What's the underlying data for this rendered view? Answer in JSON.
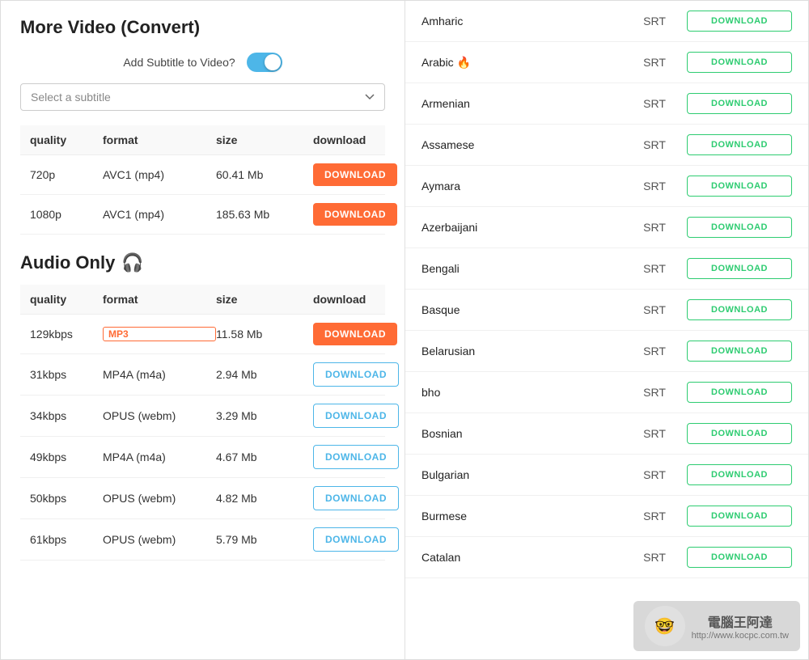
{
  "left": {
    "section_title": "More Video (Convert)",
    "subtitle_label": "Add Subtitle to Video?",
    "toggle_on": true,
    "subtitle_placeholder": "Select a subtitle",
    "video_table": {
      "headers": [
        "quality",
        "format",
        "size",
        "download"
      ],
      "rows": [
        {
          "quality": "720p",
          "format": "AVC1 (mp4)",
          "size": "60.41 Mb",
          "btn": "DOWNLOAD",
          "btn_type": "orange"
        },
        {
          "quality": "1080p",
          "format": "AVC1 (mp4)",
          "size": "185.63 Mb",
          "btn": "DOWNLOAD",
          "btn_type": "orange"
        }
      ]
    },
    "audio_title": "Audio Only",
    "audio_table": {
      "headers": [
        "quality",
        "format",
        "size",
        "download"
      ],
      "rows": [
        {
          "quality": "129kbps",
          "format": "MP3",
          "format_badge": true,
          "size": "11.58 Mb",
          "btn": "DOWNLOAD",
          "btn_type": "orange"
        },
        {
          "quality": "31kbps",
          "format": "MP4A (m4a)",
          "format_badge": false,
          "size": "2.94 Mb",
          "btn": "DOWNLOAD",
          "btn_type": "outline"
        },
        {
          "quality": "34kbps",
          "format": "OPUS (webm)",
          "format_badge": false,
          "size": "3.29 Mb",
          "btn": "DOWNLOAD",
          "btn_type": "outline"
        },
        {
          "quality": "49kbps",
          "format": "MP4A (m4a)",
          "format_badge": false,
          "size": "4.67 Mb",
          "btn": "DOWNLOAD",
          "btn_type": "outline"
        },
        {
          "quality": "50kbps",
          "format": "OPUS (webm)",
          "format_badge": false,
          "size": "4.82 Mb",
          "btn": "DOWNLOAD",
          "btn_type": "outline"
        },
        {
          "quality": "61kbps",
          "format": "OPUS (webm)",
          "format_badge": false,
          "size": "5.79 Mb",
          "btn": "DOWNLOAD",
          "btn_type": "outline"
        }
      ]
    }
  },
  "right": {
    "subtitles": [
      {
        "lang": "Amharic",
        "emoji": "",
        "format": "SRT",
        "btn": "DOWNLOAD"
      },
      {
        "lang": "Arabic",
        "emoji": "🔥",
        "format": "SRT",
        "btn": "DOWNLOAD"
      },
      {
        "lang": "Armenian",
        "emoji": "",
        "format": "SRT",
        "btn": "DOWNLOAD"
      },
      {
        "lang": "Assamese",
        "emoji": "",
        "format": "SRT",
        "btn": "DOWNLOAD"
      },
      {
        "lang": "Aymara",
        "emoji": "",
        "format": "SRT",
        "btn": "DOWNLOAD"
      },
      {
        "lang": "Azerbaijani",
        "emoji": "",
        "format": "SRT",
        "btn": "DOWNLOAD"
      },
      {
        "lang": "Bengali",
        "emoji": "",
        "format": "SRT",
        "btn": "DOWNLOAD"
      },
      {
        "lang": "Basque",
        "emoji": "",
        "format": "SRT",
        "btn": "DOWNLOAD"
      },
      {
        "lang": "Belarusian",
        "emoji": "",
        "format": "SRT",
        "btn": "DOWNLOAD"
      },
      {
        "lang": "bho",
        "emoji": "",
        "format": "SRT",
        "btn": "DOWNLOAD"
      },
      {
        "lang": "Bosnian",
        "emoji": "",
        "format": "SRT",
        "btn": "DOWNLOAD"
      },
      {
        "lang": "Bulgarian",
        "emoji": "",
        "format": "SRT",
        "btn": "DOWNLOAD"
      },
      {
        "lang": "Burmese",
        "emoji": "",
        "format": "SRT",
        "btn": "DOWNLOAD"
      },
      {
        "lang": "Catalan",
        "emoji": "",
        "format": "SRT",
        "btn": "DOWNLOAD"
      }
    ]
  },
  "watermark": {
    "text": "電腦王阿達",
    "url": "http://www.kocpc.com.tw"
  }
}
